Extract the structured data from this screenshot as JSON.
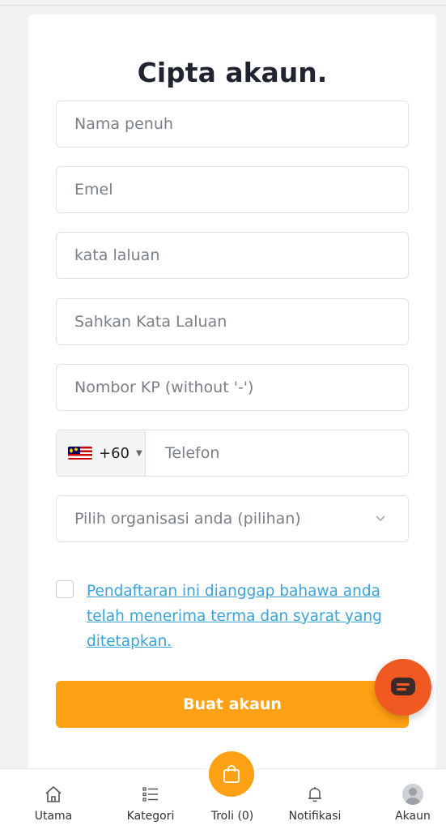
{
  "form": {
    "title": "Cipta akaun.",
    "fields": {
      "full_name_placeholder": "Nama penuh",
      "email_placeholder": "Emel",
      "password_placeholder": "kata laluan",
      "confirm_password_placeholder": "Sahkan Kata Laluan",
      "ic_number_placeholder": "Nombor KP (without '-')",
      "phone_country_code": "+60",
      "phone_country_flag": "flag-my-icon",
      "phone_placeholder": "Telefon",
      "organisation_placeholder": "Pilih organisasi anda (pilihan)"
    },
    "terms_text": "Pendaftaran ini dianggap bahawa anda telah menerima terma dan syarat yang ditetapkan.",
    "submit_label": "Buat akaun"
  },
  "bottom_nav": {
    "items": [
      {
        "label": "Utama",
        "icon": "home-icon"
      },
      {
        "label": "Kategori",
        "icon": "list-icon"
      },
      {
        "label": "Troli (0)",
        "icon": "shopping-bag-icon"
      },
      {
        "label": "Notifikasi",
        "icon": "bell-icon"
      },
      {
        "label": "Akaun",
        "icon": "avatar-icon"
      }
    ]
  },
  "colors": {
    "accent": "#ffa114",
    "link": "#3aa3d9",
    "chat": "#f05a22",
    "page_bg": "#f2f2f4"
  }
}
